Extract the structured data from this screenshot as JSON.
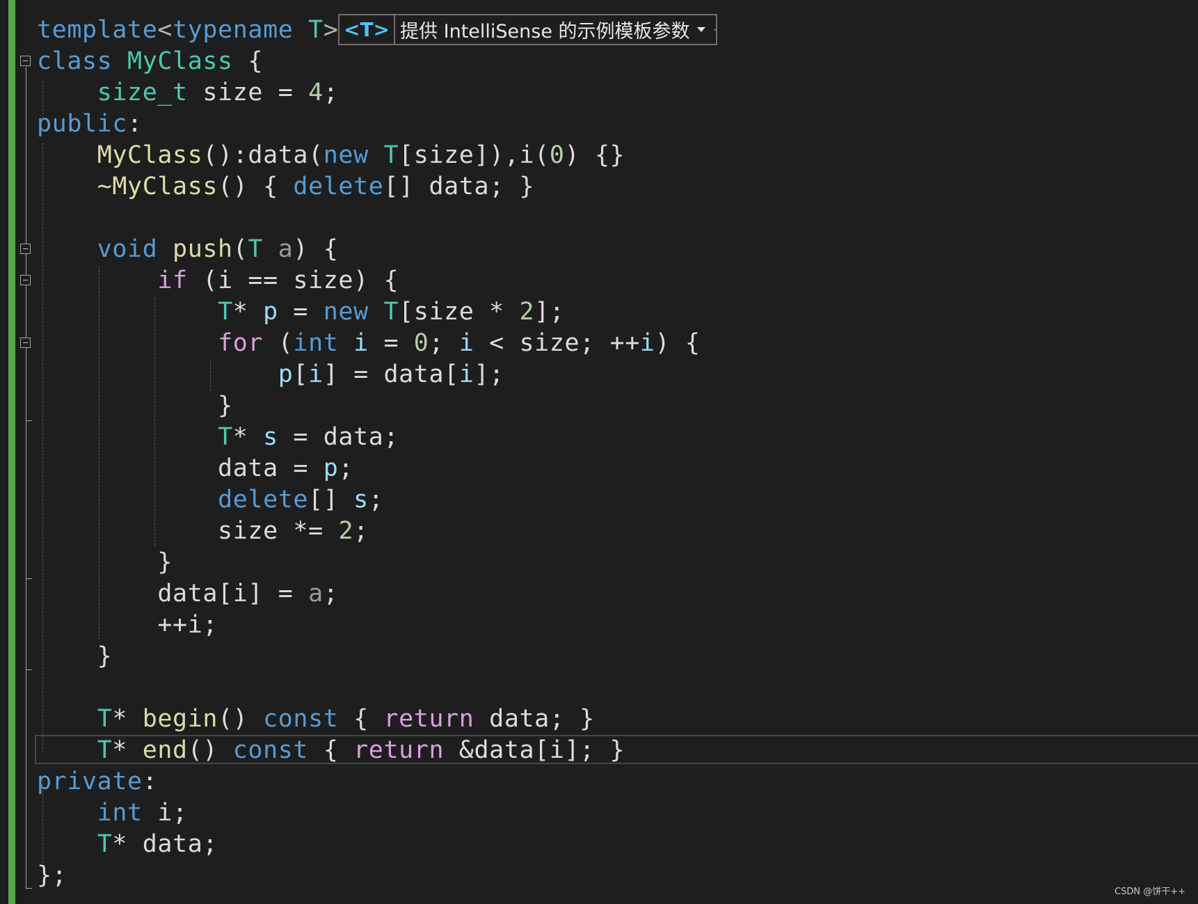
{
  "hint": {
    "tag": "<T>",
    "text": "提供 IntelliSense 的示例模板参数",
    "dropdown_icon": "chevron-down-icon",
    "edit_icon": "pencil-icon"
  },
  "code": {
    "line_01": [
      {
        "t": "template",
        "c": "kw"
      },
      {
        "t": "<",
        "c": "pun"
      },
      {
        "t": "typename",
        "c": "kw"
      },
      {
        "t": " ",
        "c": "id"
      },
      {
        "t": "T",
        "c": "typ"
      },
      {
        "t": ">",
        "c": "pun"
      }
    ],
    "line_02": [
      {
        "t": "class",
        "c": "kw"
      },
      {
        "t": " ",
        "c": "id"
      },
      {
        "t": "MyClass",
        "c": "typ"
      },
      {
        "t": " {",
        "c": "id"
      }
    ],
    "line_03": [
      {
        "t": "    ",
        "c": "id"
      },
      {
        "t": "size_t",
        "c": "typ"
      },
      {
        "t": " size = ",
        "c": "mem"
      },
      {
        "t": "4",
        "c": "num"
      },
      {
        "t": ";",
        "c": "id"
      }
    ],
    "line_04": [
      {
        "t": "public",
        "c": "kw"
      },
      {
        "t": ":",
        "c": "id"
      }
    ],
    "line_05": [
      {
        "t": "    ",
        "c": "id"
      },
      {
        "t": "MyClass",
        "c": "fn"
      },
      {
        "t": "():",
        "c": "id"
      },
      {
        "t": "data",
        "c": "mem"
      },
      {
        "t": "(",
        "c": "id"
      },
      {
        "t": "new",
        "c": "kw"
      },
      {
        "t": " ",
        "c": "id"
      },
      {
        "t": "T",
        "c": "typ"
      },
      {
        "t": "[size]),",
        "c": "id"
      },
      {
        "t": "i",
        "c": "mem"
      },
      {
        "t": "(",
        "c": "id"
      },
      {
        "t": "0",
        "c": "num"
      },
      {
        "t": ") {}",
        "c": "id"
      }
    ],
    "line_06": [
      {
        "t": "    ",
        "c": "id"
      },
      {
        "t": "~MyClass",
        "c": "fn"
      },
      {
        "t": "() { ",
        "c": "id"
      },
      {
        "t": "delete",
        "c": "kw"
      },
      {
        "t": "[] data; }",
        "c": "id"
      }
    ],
    "line_07": [],
    "line_08": [
      {
        "t": "    ",
        "c": "id"
      },
      {
        "t": "void",
        "c": "kw"
      },
      {
        "t": " ",
        "c": "id"
      },
      {
        "t": "push",
        "c": "fn"
      },
      {
        "t": "(",
        "c": "id"
      },
      {
        "t": "T",
        "c": "typ"
      },
      {
        "t": " ",
        "c": "id"
      },
      {
        "t": "a",
        "c": "par"
      },
      {
        "t": ") {",
        "c": "id"
      }
    ],
    "line_09": [
      {
        "t": "        ",
        "c": "id"
      },
      {
        "t": "if",
        "c": "ctl"
      },
      {
        "t": " (i == size) {",
        "c": "id"
      }
    ],
    "line_10": [
      {
        "t": "            ",
        "c": "id"
      },
      {
        "t": "T",
        "c": "typ"
      },
      {
        "t": "* ",
        "c": "id"
      },
      {
        "t": "p",
        "c": "lv"
      },
      {
        "t": " = ",
        "c": "id"
      },
      {
        "t": "new",
        "c": "kw"
      },
      {
        "t": " ",
        "c": "id"
      },
      {
        "t": "T",
        "c": "typ"
      },
      {
        "t": "[size * ",
        "c": "id"
      },
      {
        "t": "2",
        "c": "num"
      },
      {
        "t": "];",
        "c": "id"
      }
    ],
    "line_11": [
      {
        "t": "            ",
        "c": "id"
      },
      {
        "t": "for",
        "c": "ctl"
      },
      {
        "t": " (",
        "c": "id"
      },
      {
        "t": "int",
        "c": "kw"
      },
      {
        "t": " ",
        "c": "id"
      },
      {
        "t": "i",
        "c": "lv"
      },
      {
        "t": " = ",
        "c": "id"
      },
      {
        "t": "0",
        "c": "num"
      },
      {
        "t": "; ",
        "c": "id"
      },
      {
        "t": "i",
        "c": "lv"
      },
      {
        "t": " < size; ++",
        "c": "id"
      },
      {
        "t": "i",
        "c": "lv"
      },
      {
        "t": ") {",
        "c": "id"
      }
    ],
    "line_12": [
      {
        "t": "                ",
        "c": "id"
      },
      {
        "t": "p",
        "c": "lv"
      },
      {
        "t": "[",
        "c": "id"
      },
      {
        "t": "i",
        "c": "lv"
      },
      {
        "t": "] = data[",
        "c": "id"
      },
      {
        "t": "i",
        "c": "lv"
      },
      {
        "t": "];",
        "c": "id"
      }
    ],
    "line_13": [
      {
        "t": "            }",
        "c": "id"
      }
    ],
    "line_14": [
      {
        "t": "            ",
        "c": "id"
      },
      {
        "t": "T",
        "c": "typ"
      },
      {
        "t": "* ",
        "c": "id"
      },
      {
        "t": "s",
        "c": "lv"
      },
      {
        "t": " = data;",
        "c": "id"
      }
    ],
    "line_15": [
      {
        "t": "            data = ",
        "c": "id"
      },
      {
        "t": "p",
        "c": "lv"
      },
      {
        "t": ";",
        "c": "id"
      }
    ],
    "line_16": [
      {
        "t": "            ",
        "c": "id"
      },
      {
        "t": "delete",
        "c": "kw"
      },
      {
        "t": "[] ",
        "c": "id"
      },
      {
        "t": "s",
        "c": "lv"
      },
      {
        "t": ";",
        "c": "id"
      }
    ],
    "line_17": [
      {
        "t": "            size *= ",
        "c": "id"
      },
      {
        "t": "2",
        "c": "num"
      },
      {
        "t": ";",
        "c": "id"
      }
    ],
    "line_18": [
      {
        "t": "        }",
        "c": "id"
      }
    ],
    "line_19": [
      {
        "t": "        data[i] = ",
        "c": "id"
      },
      {
        "t": "a",
        "c": "par"
      },
      {
        "t": ";",
        "c": "id"
      }
    ],
    "line_20": [
      {
        "t": "        ++i;",
        "c": "id"
      }
    ],
    "line_21": [
      {
        "t": "    }",
        "c": "id"
      }
    ],
    "line_22": [],
    "line_23": [
      {
        "t": "    ",
        "c": "id"
      },
      {
        "t": "T",
        "c": "typ"
      },
      {
        "t": "* ",
        "c": "id"
      },
      {
        "t": "begin",
        "c": "fn"
      },
      {
        "t": "() ",
        "c": "id"
      },
      {
        "t": "const",
        "c": "kw"
      },
      {
        "t": " { ",
        "c": "id"
      },
      {
        "t": "return",
        "c": "ctl"
      },
      {
        "t": " data; }",
        "c": "id"
      }
    ],
    "line_24": [
      {
        "t": "    ",
        "c": "id"
      },
      {
        "t": "T",
        "c": "typ"
      },
      {
        "t": "* ",
        "c": "id"
      },
      {
        "t": "end",
        "c": "fn"
      },
      {
        "t": "() ",
        "c": "id"
      },
      {
        "t": "const",
        "c": "kw"
      },
      {
        "t": " { ",
        "c": "id"
      },
      {
        "t": "return",
        "c": "ctl"
      },
      {
        "t": " &data[i]; }",
        "c": "id"
      }
    ],
    "line_25": [
      {
        "t": "private",
        "c": "kw"
      },
      {
        "t": ":",
        "c": "id"
      }
    ],
    "line_26": [
      {
        "t": "    ",
        "c": "id"
      },
      {
        "t": "int",
        "c": "kw"
      },
      {
        "t": " i;",
        "c": "id"
      }
    ],
    "line_27": [
      {
        "t": "    ",
        "c": "id"
      },
      {
        "t": "T",
        "c": "typ"
      },
      {
        "t": "* data;",
        "c": "id"
      }
    ],
    "line_28": [
      {
        "t": "};",
        "c": "id"
      }
    ]
  },
  "watermark": "CSDN @饼干++",
  "colors": {
    "background": "#1e1e1e",
    "keyword": "#569cd6",
    "control": "#d8a0df",
    "type": "#4ec9b0",
    "function": "#dcdcaa",
    "number": "#b5cea8",
    "local": "#9cdcfe",
    "change_bar": "#57a64a"
  }
}
